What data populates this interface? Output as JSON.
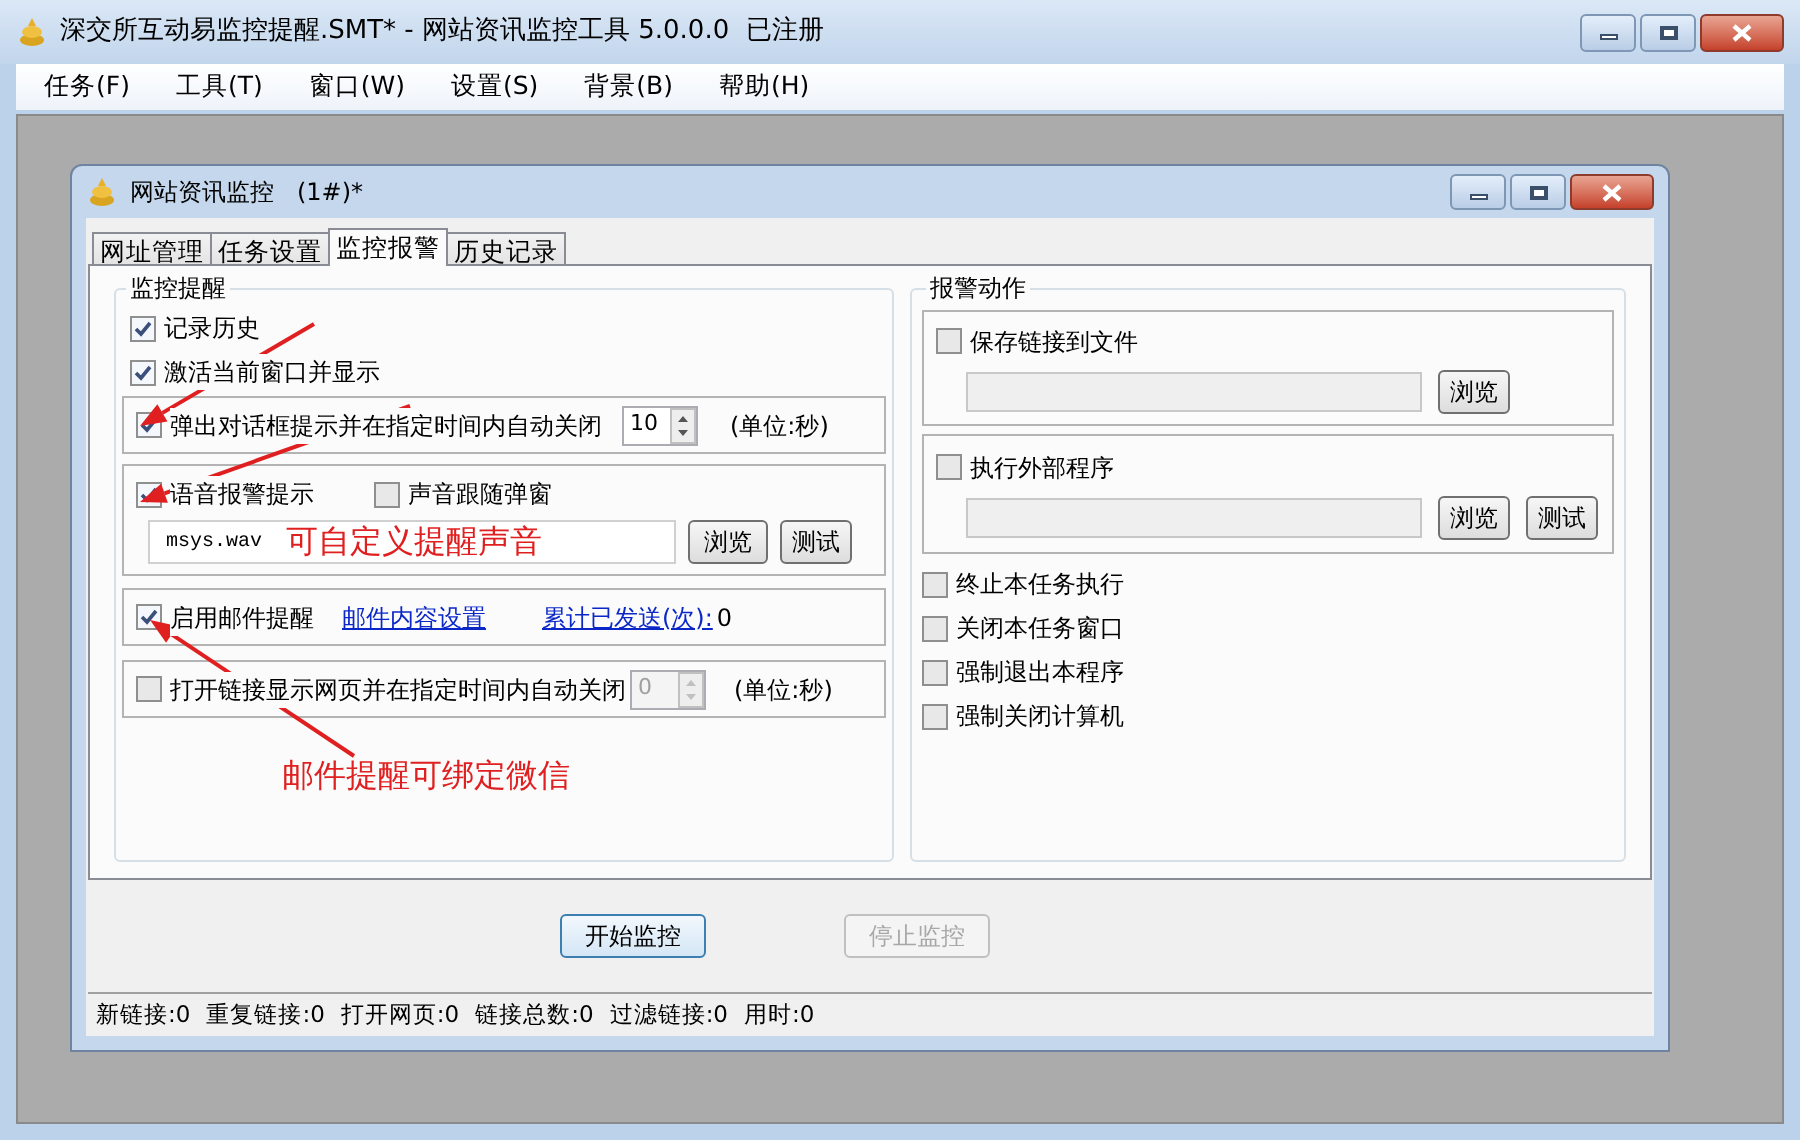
{
  "window": {
    "title": "深交所互动易监控提醒.SMT* - 网站资讯监控工具 5.0.0.0  已注册"
  },
  "menu": [
    "任务(F)",
    "工具(T)",
    "窗口(W)",
    "设置(S)",
    "背景(B)",
    "帮助(H)"
  ],
  "child": {
    "title": "网站资讯监控   (1#)*",
    "tabs": [
      {
        "label": "网址管理",
        "selected": false
      },
      {
        "label": "任务设置",
        "selected": false
      },
      {
        "label": "监控报警",
        "selected": true
      },
      {
        "label": "历史记录",
        "selected": false
      }
    ],
    "alert_group": {
      "title": "监控提醒",
      "record_history": {
        "label": "记录历史",
        "checked": true
      },
      "activate_window": {
        "label": "激活当前窗口并显示",
        "checked": true
      },
      "popup": {
        "label": "弹出对话框提示并在指定时间内自动关闭",
        "checked": true,
        "spinner": {
          "value": "10",
          "disabled": false
        },
        "unit": "(单位:秒)"
      },
      "sound": {
        "label": "语音报警提示",
        "checked": true,
        "follow": {
          "label": "声音跟随弹窗",
          "checked": false
        },
        "file": "msys.wav",
        "buttons": [
          "浏览",
          "测试"
        ],
        "annotation": "可自定义提醒声音"
      },
      "email": {
        "label": "启用邮件提醒",
        "checked": true,
        "link": "邮件内容设置",
        "count_link": "累计已发送(次):",
        "count": "0"
      },
      "open_link": {
        "label": "打开链接显示网页并在指定时间内自动关闭",
        "checked": false,
        "spinner": {
          "value": "0",
          "disabled": true
        },
        "unit": "(单位:秒)"
      },
      "annotation": "邮件提醒可绑定微信"
    },
    "action_group": {
      "title": "报警动作",
      "save_file": {
        "label": "保存链接到文件",
        "checked": false,
        "buttons": [
          "浏览"
        ]
      },
      "run_program": {
        "label": "执行外部程序",
        "checked": false,
        "buttons": [
          "浏览",
          "测试"
        ]
      },
      "options": [
        {
          "label": "终止本任务执行",
          "checked": false
        },
        {
          "label": "关闭本任务窗口",
          "checked": false
        },
        {
          "label": "强制退出本程序",
          "checked": false
        },
        {
          "label": "强制关闭计算机",
          "checked": false
        }
      ]
    },
    "buttons": [
      {
        "label": "开始监控",
        "disabled": false
      },
      {
        "label": "停止监控",
        "disabled": true
      }
    ],
    "status_bar": [
      "新链接:0",
      "重复链接:0",
      "打开网页:0",
      "链接总数:0",
      "过滤链接:0",
      "用时:0"
    ]
  }
}
